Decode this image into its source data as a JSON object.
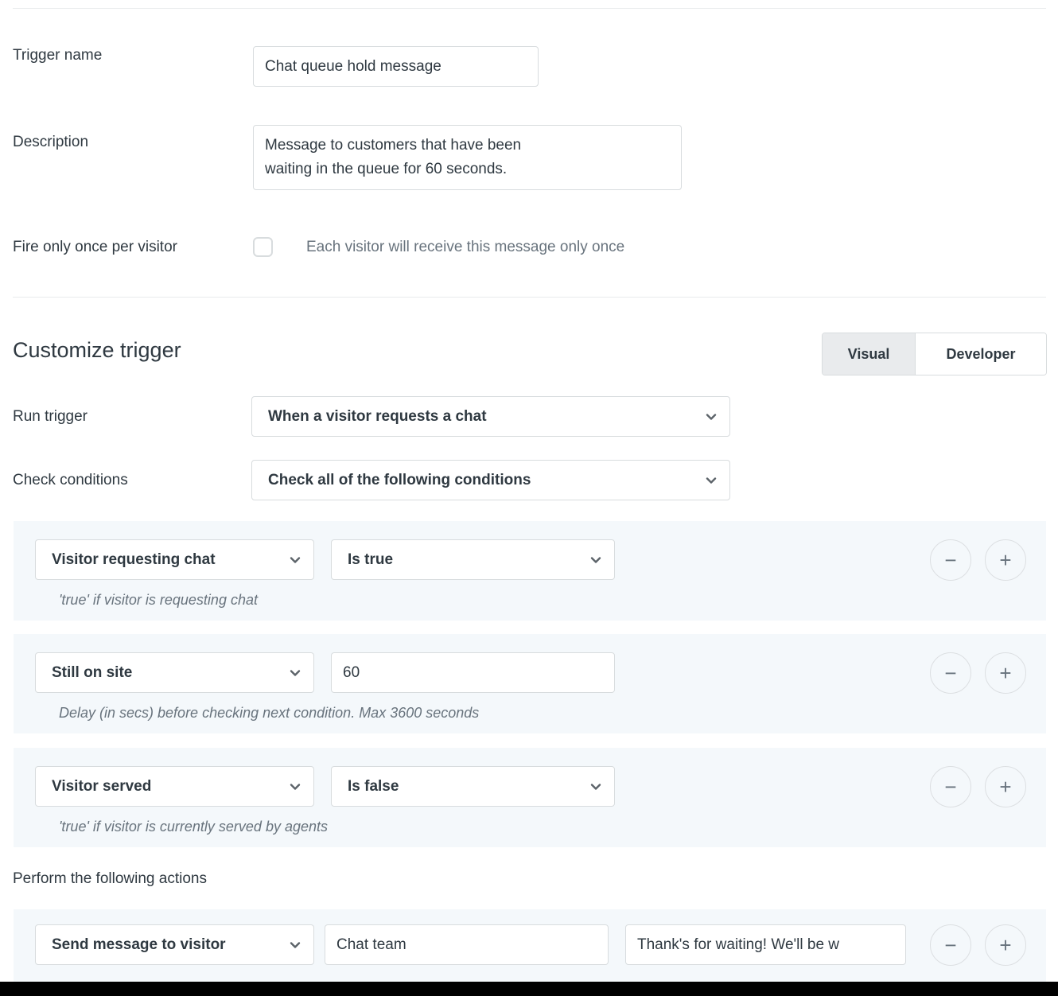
{
  "form": {
    "trigger_name": {
      "label": "Trigger name",
      "value": "Chat queue hold message",
      "placeholder": "Trigger name"
    },
    "description": {
      "label": "Description",
      "value": "Message to customers that have been\nwaiting in the queue for 60 seconds.",
      "placeholder": "Description"
    },
    "fire_once": {
      "label": "Fire only once per visitor",
      "checkbox_state": "unchecked",
      "hint": "Each visitor will receive this message only once"
    }
  },
  "customize": {
    "title": "Customize trigger",
    "mode_toggle": {
      "selected": "Visual",
      "options": [
        {
          "label": "Visual",
          "selected": true
        },
        {
          "label": "Developer",
          "selected": false
        }
      ]
    },
    "run_trigger": {
      "label": "Run trigger",
      "value": "When a visitor requests a chat",
      "icon": "chevron-down-icon"
    },
    "check_conditions": {
      "label": "Check conditions",
      "value": "Check all of the following conditions",
      "icon": "chevron-down-icon"
    }
  },
  "conditions": [
    {
      "field": "Visitor requesting chat",
      "operator_type": "select",
      "operator": "Is true",
      "hint": "'true' if visitor is requesting chat",
      "remove_label": "−",
      "add_label": "+"
    },
    {
      "field": "Still on site",
      "operator_type": "text",
      "operator": "60",
      "hint": "Delay (in secs) before checking next condition. Max 3600 seconds",
      "remove_label": "−",
      "add_label": "+"
    },
    {
      "field": "Visitor served",
      "operator_type": "select",
      "operator": "Is false",
      "hint": "'true' if visitor is currently served by agents",
      "remove_label": "−",
      "add_label": "+"
    }
  ],
  "actions": {
    "label": "Perform the following actions",
    "rows": [
      {
        "action": "Send message to visitor",
        "sender": "Chat team",
        "message": "Thank's for waiting! We'll be w",
        "remove_label": "−",
        "add_label": "+"
      }
    ]
  },
  "colors": {
    "panel_bg": "#f4f8fb",
    "border": "#d8dcde",
    "text": "#2f3941",
    "muted_text": "#68737d",
    "toggle_selected_bg": "#e9ebed",
    "divider": "#e9ebed",
    "bottom_bar": "#000000"
  }
}
